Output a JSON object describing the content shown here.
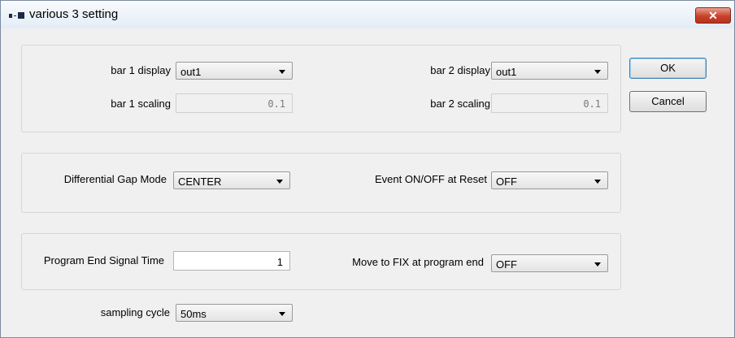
{
  "window": {
    "title": "various 3 setting",
    "close_glyph": "✕"
  },
  "buttons": {
    "ok": "OK",
    "cancel": "Cancel"
  },
  "group1": {
    "bar1_display_label": "bar 1 display",
    "bar1_display_value": "out1",
    "bar1_scaling_label": "bar 1 scaling",
    "bar1_scaling_value": "0.1",
    "bar2_display_label": "bar 2 display",
    "bar2_display_value": "out1",
    "bar2_scaling_label": "bar 2 scaling",
    "bar2_scaling_value": "0.1"
  },
  "group2": {
    "gap_mode_label": "Differential Gap Mode",
    "gap_mode_value": "CENTER",
    "event_reset_label": "Event ON/OFF at Reset",
    "event_reset_value": "OFF"
  },
  "group3": {
    "end_signal_label": "Program End Signal Time",
    "end_signal_value": "1",
    "move_fix_label": "Move to FIX at program end",
    "move_fix_value": "OFF"
  },
  "sampling": {
    "label": "sampling cycle",
    "value": "50ms"
  },
  "icons": {
    "app": "app-icon",
    "close": "close-icon",
    "dropdown": "chevron-down-icon"
  }
}
